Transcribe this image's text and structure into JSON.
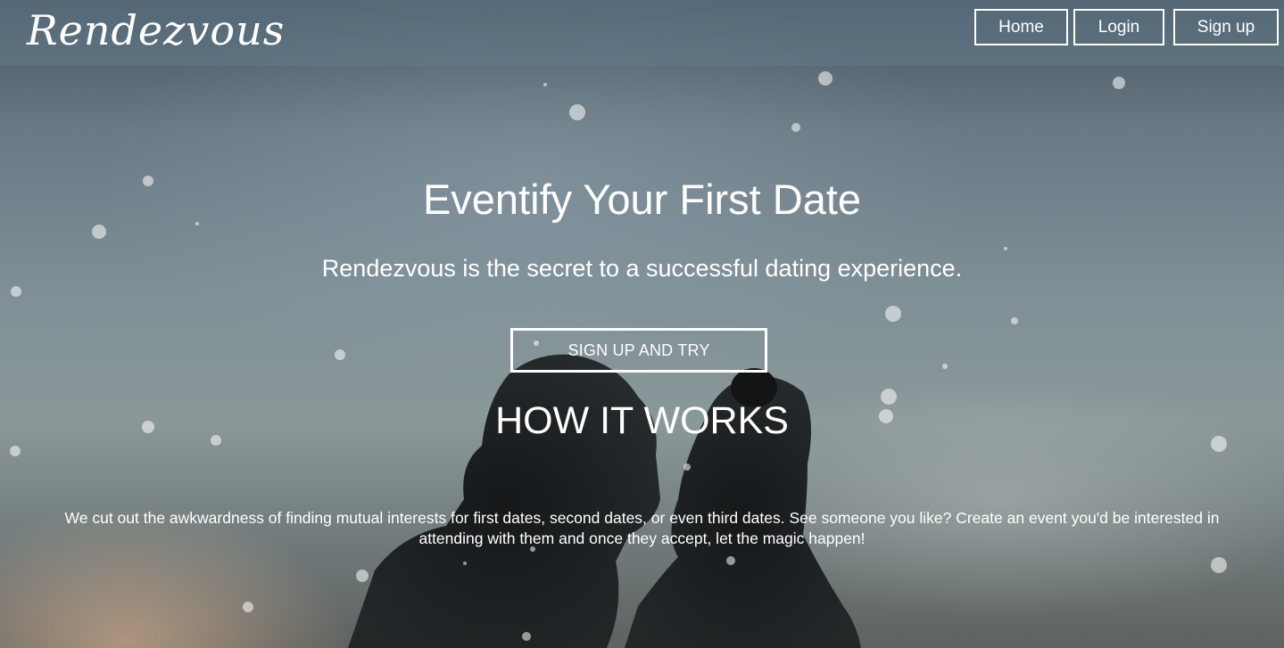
{
  "navbar": {
    "brand": "Rendezvous",
    "home_label": "Home",
    "login_label": "Login",
    "signup_label": "Sign up"
  },
  "hero": {
    "title": "Eventify Your First Date",
    "subtitle": "Rendezvous is the secret to a successful dating experience.",
    "cta_label": "SIGN UP AND TRY"
  },
  "how_it_works": {
    "heading": "HOW IT WORKS",
    "text": "We cut out the awkwardness of finding mutual interests for first dates, second dates, or even third dates. See someone you like? Create an event you'd be interested in attending with them and once they accept, let the magic happen!"
  },
  "colors": {
    "text": "#ffffff",
    "navbar_bg": "rgba(98,122,138,0.55)"
  }
}
